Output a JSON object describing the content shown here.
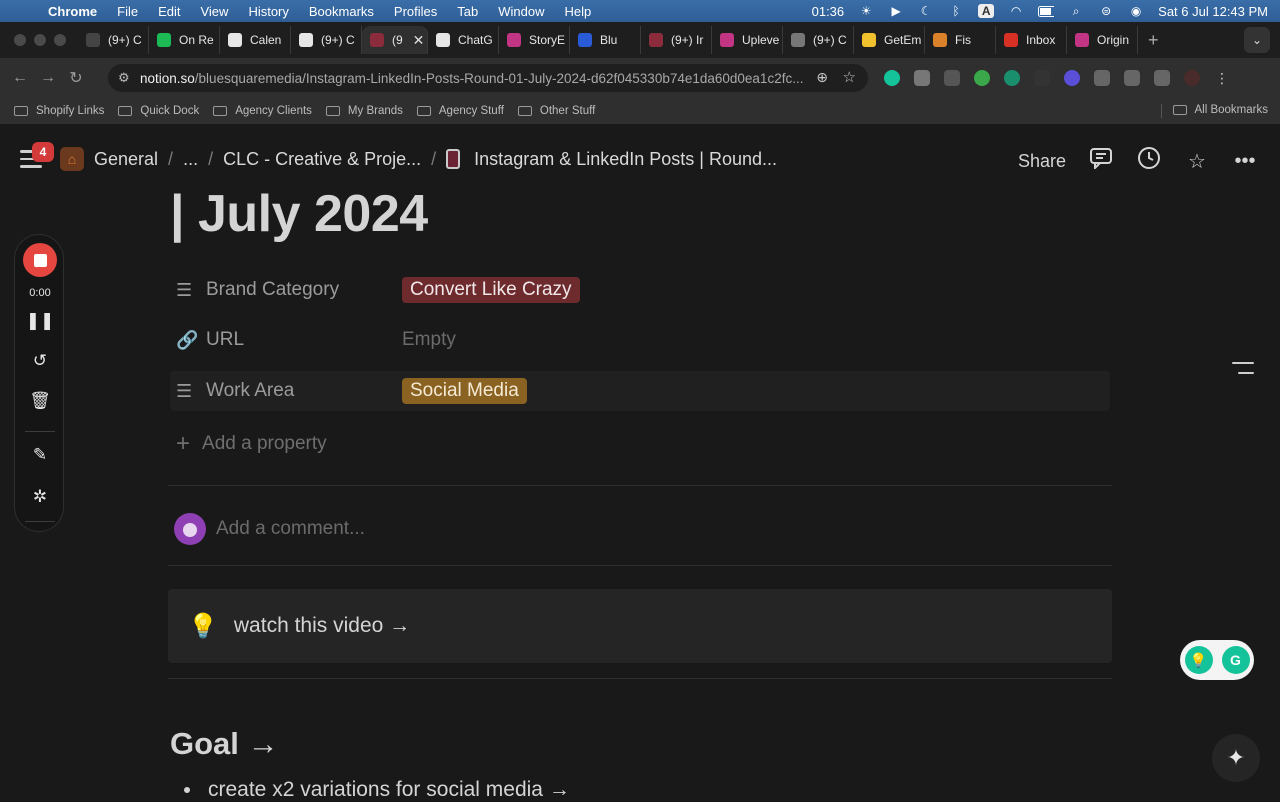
{
  "menubar": {
    "app": "Chrome",
    "items": [
      "File",
      "Edit",
      "View",
      "History",
      "Bookmarks",
      "Profiles",
      "Tab",
      "Window",
      "Help"
    ],
    "time_rec": "01:36",
    "datetime": "Sat 6 Jul  12:43 PM"
  },
  "tabs": [
    {
      "label": "(9+) C",
      "color": "#444"
    },
    {
      "label": "On Re",
      "color": "#1db954"
    },
    {
      "label": "Calen",
      "color": "#e6e6e6"
    },
    {
      "label": "(9+) C",
      "color": "#e6e6e6"
    },
    {
      "label": "(9",
      "color": "#8b2c3c",
      "active": true
    },
    {
      "label": "ChatG",
      "color": "#e6e6e6"
    },
    {
      "label": "StoryE",
      "color": "#c13584"
    },
    {
      "label": "Blu",
      "color": "#2a5bd7"
    },
    {
      "label": "(9+) Ir",
      "color": "#8b2c3c"
    },
    {
      "label": "Upleve",
      "color": "#c13584"
    },
    {
      "label": "(9+) C",
      "color": "#777"
    },
    {
      "label": "GetEm",
      "color": "#f2c12e"
    },
    {
      "label": "Fis",
      "color": "#d9822b"
    },
    {
      "label": "Inbox",
      "color": "#d93025"
    },
    {
      "label": "Origin",
      "color": "#c13584"
    }
  ],
  "url": {
    "host": "notion.so",
    "path": "/bluesquaremedia/Instagram-LinkedIn-Posts-Round-01-July-2024-d62f045330b74e1da60d0ea1c2fc..."
  },
  "bookmarks": [
    "Shopify Links",
    "Quick Dock",
    "Agency Clients",
    "My Brands",
    "Agency Stuff",
    "Other Stuff"
  ],
  "bookmarks_all": "All Bookmarks",
  "notion": {
    "badge": "4",
    "crumbs": [
      "General",
      "...",
      "CLC - Creative & Proje...",
      "Instagram & LinkedIn Posts | Round..."
    ],
    "share": "Share",
    "title": "| July 2024",
    "properties": [
      {
        "name": "Brand Category",
        "value": "Convert Like Crazy",
        "icon": "list-icon"
      },
      {
        "name": "URL",
        "value": "Empty",
        "icon": "link-icon"
      },
      {
        "name": "Work Area",
        "value": "Social Media",
        "icon": "list-icon"
      }
    ],
    "add_property": "Add a property",
    "comment_placeholder": "Add a comment...",
    "callout": "watch this video →",
    "heading": "Goal →",
    "bullet": "create x2 variations for social media →"
  },
  "recorder": {
    "time": "0:00"
  }
}
